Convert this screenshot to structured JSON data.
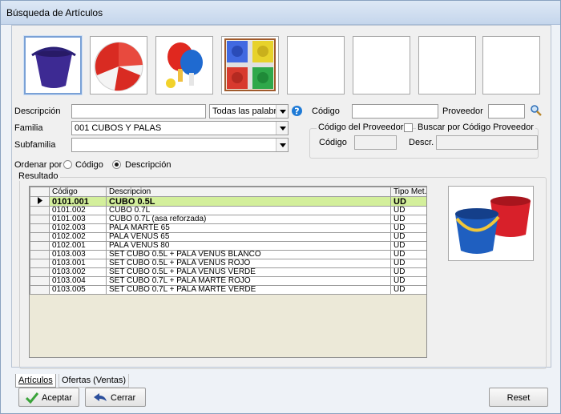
{
  "window": {
    "title": "Búsqueda de Artículos"
  },
  "search": {
    "descripcion_label": "Descripción",
    "descripcion_value": "",
    "words_mode": "Todas las palabras",
    "codigo_label": "Código",
    "codigo_value": "",
    "proveedor_label": "Proveedor",
    "proveedor_value": "",
    "familia_label": "Familia",
    "familia_value": "001 CUBOS Y PALAS",
    "subfamilia_label": "Subfamilia",
    "subfamilia_value": "",
    "prov_group_label": "Código del Proveedor",
    "buscar_por_label": "Buscar por Código Proveedor",
    "prov_codigo_label": "Código",
    "prov_descr_label": "Descr."
  },
  "sort": {
    "label": "Ordenar por",
    "options": [
      "Código",
      "Descripción"
    ],
    "selected": "Descripción"
  },
  "results": {
    "group_label": "Resultado",
    "columns": [
      "Código",
      "Descripcion",
      "Tipo Met."
    ],
    "rows": [
      {
        "codigo": "0101.001",
        "descripcion": "CUBO 0.5L",
        "tipo": "UD",
        "current": true
      },
      {
        "codigo": "0101.002",
        "descripcion": "CUBO 0.7L",
        "tipo": "UD"
      },
      {
        "codigo": "0101.003",
        "descripcion": "CUBO 0.7L (asa reforzada)",
        "tipo": "UD"
      },
      {
        "codigo": "0102.003",
        "descripcion": "PALA MARTE 65",
        "tipo": "UD"
      },
      {
        "codigo": "0102.002",
        "descripcion": "PALA VENUS 65",
        "tipo": "UD"
      },
      {
        "codigo": "0102.001",
        "descripcion": "PALA VENUS 80",
        "tipo": "UD"
      },
      {
        "codigo": "0103.003",
        "descripcion": "SET CUBO 0.5L + PALA VENUS BLANCO",
        "tipo": "UD"
      },
      {
        "codigo": "0103.001",
        "descripcion": "SET CUBO 0.5L + PALA VENUS ROJO",
        "tipo": "UD"
      },
      {
        "codigo": "0103.002",
        "descripcion": "SET CUBO 0.5L + PALA VENUS VERDE",
        "tipo": "UD"
      },
      {
        "codigo": "0103.004",
        "descripcion": "SET CUBO 0.7L + PALA MARTE ROJO",
        "tipo": "UD"
      },
      {
        "codigo": "0103.005",
        "descripcion": "SET CUBO 0.7L + PALA MARTE VERDE",
        "tipo": "UD"
      }
    ]
  },
  "tabs": [
    "Artículos",
    "Ofertas (Ventas)"
  ],
  "buttons": {
    "aceptar": "Aceptar",
    "cerrar": "Cerrar",
    "reset": "Reset"
  },
  "icons": {
    "help": "help-icon",
    "search": "magnifier-icon",
    "accept": "checkmark-icon",
    "close": "back-arrow-icon",
    "row_pointer": "row-pointer-icon"
  },
  "colors": {
    "current_row": "#d3ef9b",
    "help": "#1e7ad6",
    "accept": "#3aa33a"
  }
}
